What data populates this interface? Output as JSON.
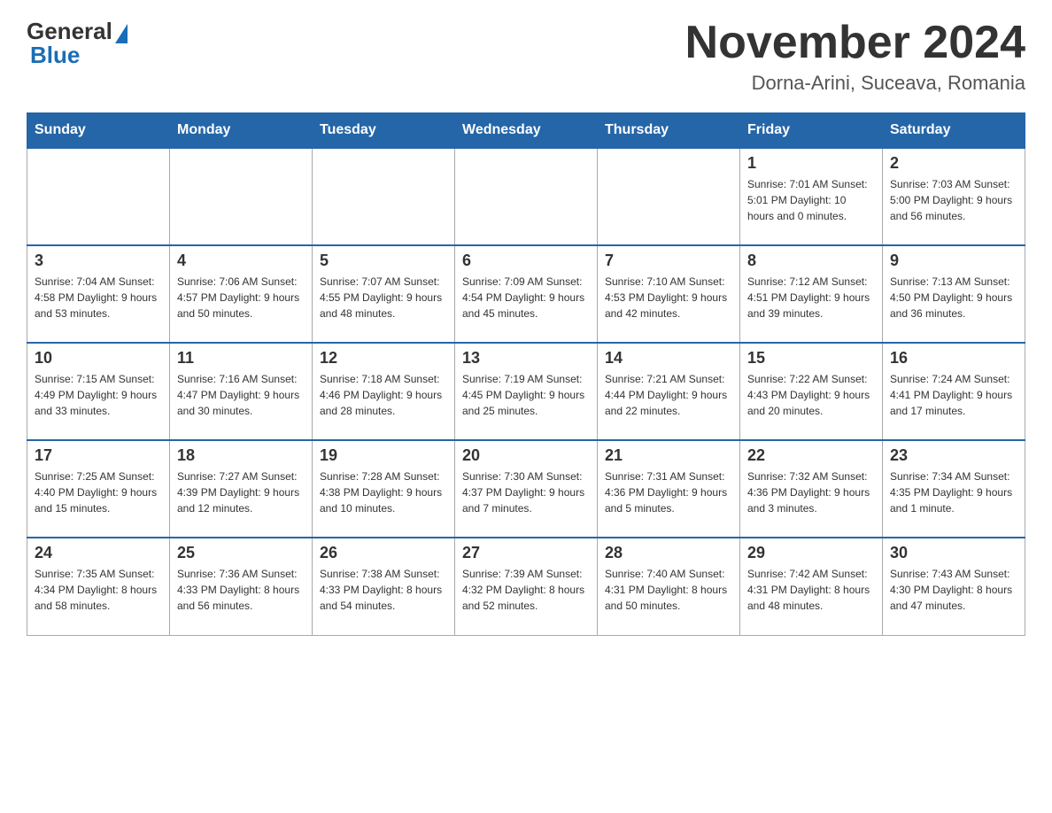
{
  "header": {
    "logo_general": "General",
    "logo_blue": "Blue",
    "month_title": "November 2024",
    "location": "Dorna-Arini, Suceava, Romania"
  },
  "weekdays": [
    "Sunday",
    "Monday",
    "Tuesday",
    "Wednesday",
    "Thursday",
    "Friday",
    "Saturday"
  ],
  "weeks": [
    [
      {
        "day": "",
        "info": ""
      },
      {
        "day": "",
        "info": ""
      },
      {
        "day": "",
        "info": ""
      },
      {
        "day": "",
        "info": ""
      },
      {
        "day": "",
        "info": ""
      },
      {
        "day": "1",
        "info": "Sunrise: 7:01 AM\nSunset: 5:01 PM\nDaylight: 10 hours and 0 minutes."
      },
      {
        "day": "2",
        "info": "Sunrise: 7:03 AM\nSunset: 5:00 PM\nDaylight: 9 hours and 56 minutes."
      }
    ],
    [
      {
        "day": "3",
        "info": "Sunrise: 7:04 AM\nSunset: 4:58 PM\nDaylight: 9 hours and 53 minutes."
      },
      {
        "day": "4",
        "info": "Sunrise: 7:06 AM\nSunset: 4:57 PM\nDaylight: 9 hours and 50 minutes."
      },
      {
        "day": "5",
        "info": "Sunrise: 7:07 AM\nSunset: 4:55 PM\nDaylight: 9 hours and 48 minutes."
      },
      {
        "day": "6",
        "info": "Sunrise: 7:09 AM\nSunset: 4:54 PM\nDaylight: 9 hours and 45 minutes."
      },
      {
        "day": "7",
        "info": "Sunrise: 7:10 AM\nSunset: 4:53 PM\nDaylight: 9 hours and 42 minutes."
      },
      {
        "day": "8",
        "info": "Sunrise: 7:12 AM\nSunset: 4:51 PM\nDaylight: 9 hours and 39 minutes."
      },
      {
        "day": "9",
        "info": "Sunrise: 7:13 AM\nSunset: 4:50 PM\nDaylight: 9 hours and 36 minutes."
      }
    ],
    [
      {
        "day": "10",
        "info": "Sunrise: 7:15 AM\nSunset: 4:49 PM\nDaylight: 9 hours and 33 minutes."
      },
      {
        "day": "11",
        "info": "Sunrise: 7:16 AM\nSunset: 4:47 PM\nDaylight: 9 hours and 30 minutes."
      },
      {
        "day": "12",
        "info": "Sunrise: 7:18 AM\nSunset: 4:46 PM\nDaylight: 9 hours and 28 minutes."
      },
      {
        "day": "13",
        "info": "Sunrise: 7:19 AM\nSunset: 4:45 PM\nDaylight: 9 hours and 25 minutes."
      },
      {
        "day": "14",
        "info": "Sunrise: 7:21 AM\nSunset: 4:44 PM\nDaylight: 9 hours and 22 minutes."
      },
      {
        "day": "15",
        "info": "Sunrise: 7:22 AM\nSunset: 4:43 PM\nDaylight: 9 hours and 20 minutes."
      },
      {
        "day": "16",
        "info": "Sunrise: 7:24 AM\nSunset: 4:41 PM\nDaylight: 9 hours and 17 minutes."
      }
    ],
    [
      {
        "day": "17",
        "info": "Sunrise: 7:25 AM\nSunset: 4:40 PM\nDaylight: 9 hours and 15 minutes."
      },
      {
        "day": "18",
        "info": "Sunrise: 7:27 AM\nSunset: 4:39 PM\nDaylight: 9 hours and 12 minutes."
      },
      {
        "day": "19",
        "info": "Sunrise: 7:28 AM\nSunset: 4:38 PM\nDaylight: 9 hours and 10 minutes."
      },
      {
        "day": "20",
        "info": "Sunrise: 7:30 AM\nSunset: 4:37 PM\nDaylight: 9 hours and 7 minutes."
      },
      {
        "day": "21",
        "info": "Sunrise: 7:31 AM\nSunset: 4:36 PM\nDaylight: 9 hours and 5 minutes."
      },
      {
        "day": "22",
        "info": "Sunrise: 7:32 AM\nSunset: 4:36 PM\nDaylight: 9 hours and 3 minutes."
      },
      {
        "day": "23",
        "info": "Sunrise: 7:34 AM\nSunset: 4:35 PM\nDaylight: 9 hours and 1 minute."
      }
    ],
    [
      {
        "day": "24",
        "info": "Sunrise: 7:35 AM\nSunset: 4:34 PM\nDaylight: 8 hours and 58 minutes."
      },
      {
        "day": "25",
        "info": "Sunrise: 7:36 AM\nSunset: 4:33 PM\nDaylight: 8 hours and 56 minutes."
      },
      {
        "day": "26",
        "info": "Sunrise: 7:38 AM\nSunset: 4:33 PM\nDaylight: 8 hours and 54 minutes."
      },
      {
        "day": "27",
        "info": "Sunrise: 7:39 AM\nSunset: 4:32 PM\nDaylight: 8 hours and 52 minutes."
      },
      {
        "day": "28",
        "info": "Sunrise: 7:40 AM\nSunset: 4:31 PM\nDaylight: 8 hours and 50 minutes."
      },
      {
        "day": "29",
        "info": "Sunrise: 7:42 AM\nSunset: 4:31 PM\nDaylight: 8 hours and 48 minutes."
      },
      {
        "day": "30",
        "info": "Sunrise: 7:43 AM\nSunset: 4:30 PM\nDaylight: 8 hours and 47 minutes."
      }
    ]
  ]
}
